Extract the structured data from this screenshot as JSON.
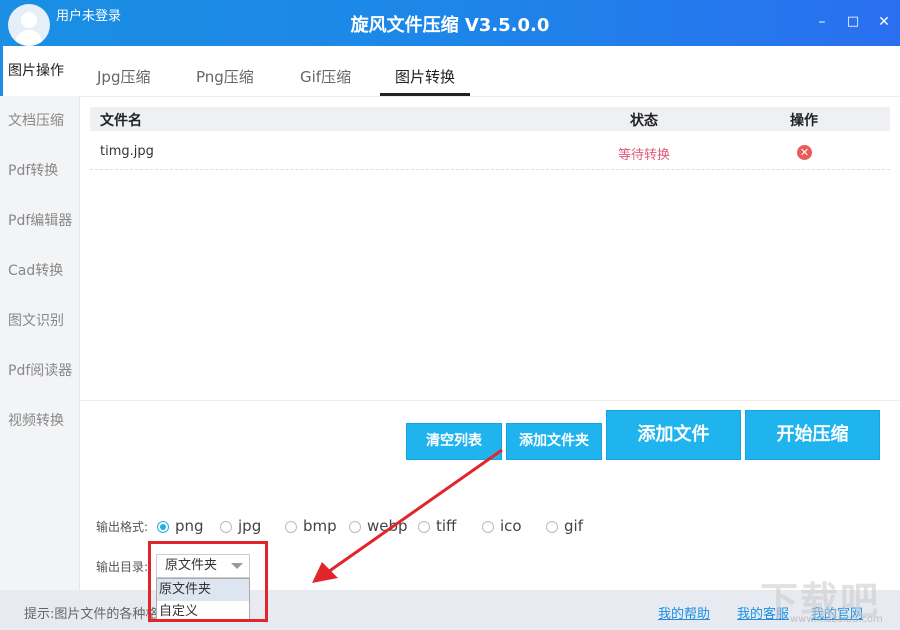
{
  "titlebar": {
    "user": "用户未登录",
    "title": "旋风文件压缩 V3.5.0.0",
    "min": "–",
    "max": "□",
    "close": "✕"
  },
  "sidebar": {
    "items": [
      {
        "label": "图片操作",
        "active": true
      },
      {
        "label": "文档压缩"
      },
      {
        "label": "Pdf转换"
      },
      {
        "label": "Pdf编辑器"
      },
      {
        "label": "Cad转换"
      },
      {
        "label": "图文识别"
      },
      {
        "label": "Pdf阅读器"
      },
      {
        "label": "视频转换"
      }
    ]
  },
  "tabs": [
    {
      "label": "Jpg压缩"
    },
    {
      "label": "Png压缩"
    },
    {
      "label": "Gif压缩"
    },
    {
      "label": "图片转换",
      "active": true
    }
  ],
  "table": {
    "headers": {
      "name": "文件名",
      "status": "状态",
      "action": "操作"
    },
    "rows": [
      {
        "name": "timg.jpg",
        "status": "等待转换"
      }
    ]
  },
  "buttons": {
    "clear": "清空列表",
    "add_folder": "添加文件夹",
    "add_file": "添加文件",
    "start": "开始压缩"
  },
  "output": {
    "format_label": "输出格式:",
    "formats": [
      "png",
      "jpg",
      "bmp",
      "webp",
      "tiff",
      "ico",
      "gif"
    ],
    "selected_format": "png",
    "dir_label": "输出目录:",
    "dir_value": "原文件夹",
    "dir_options": [
      "原文件夹",
      "自定义"
    ]
  },
  "statusbar": {
    "tip": "提示:图片文件的各种格",
    "help": "我的帮助",
    "service": "我的客服",
    "site": "我的官网"
  },
  "watermark": {
    "text": "下载吧",
    "url": "www.xiazaiba.com"
  },
  "colors": {
    "accent": "#1a8fe3",
    "button": "#1fb4ee",
    "status": "#e05a7a",
    "highlight": "#e0262b"
  }
}
